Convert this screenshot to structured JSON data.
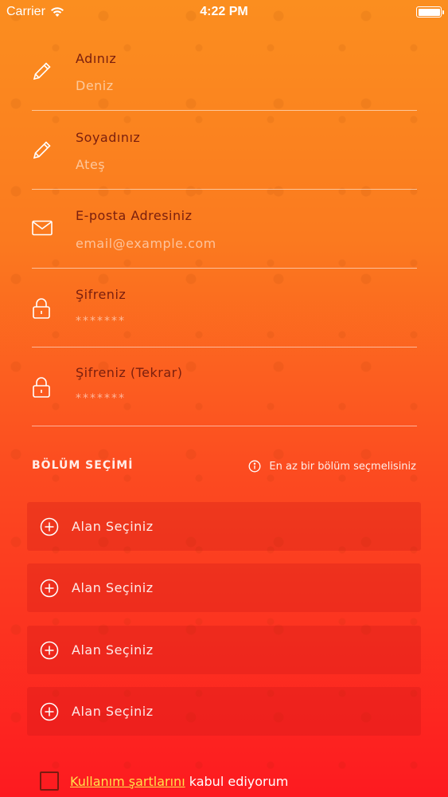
{
  "status_bar": {
    "carrier": "Carrier",
    "time": "4:22 PM"
  },
  "fields": [
    {
      "label": "Adınız",
      "value": "Deniz",
      "icon": "pencil-icon"
    },
    {
      "label": "Soyadınız",
      "value": "Ateş",
      "icon": "pencil-icon"
    },
    {
      "label": "E-posta Adresiniz",
      "placeholder": "email@example.com",
      "icon": "mail-icon"
    },
    {
      "label": "Şifreniz",
      "value": "*******",
      "icon": "lock-icon"
    },
    {
      "label": "Şifreniz (Tekrar)",
      "value": "*******",
      "icon": "lock-icon"
    }
  ],
  "section": {
    "title": "BÖLÜM SEÇİMİ",
    "note": "En az bir bölüm seçmelisiniz",
    "note_icon": "info-icon"
  },
  "areas": [
    {
      "label": "Alan Seçiniz"
    },
    {
      "label": "Alan Seçiniz"
    },
    {
      "label": "Alan Seçiniz"
    },
    {
      "label": "Alan Seçiniz"
    }
  ],
  "terms": {
    "link_text": "Kullanım şartlarını",
    "suffix": " kabul ediyorum",
    "checked": false
  },
  "colors": {
    "gradient_top": "#fb8e1f",
    "gradient_bottom": "#fd1a20",
    "label_color": "#7a1f0e",
    "link_color": "#ffe24a"
  }
}
